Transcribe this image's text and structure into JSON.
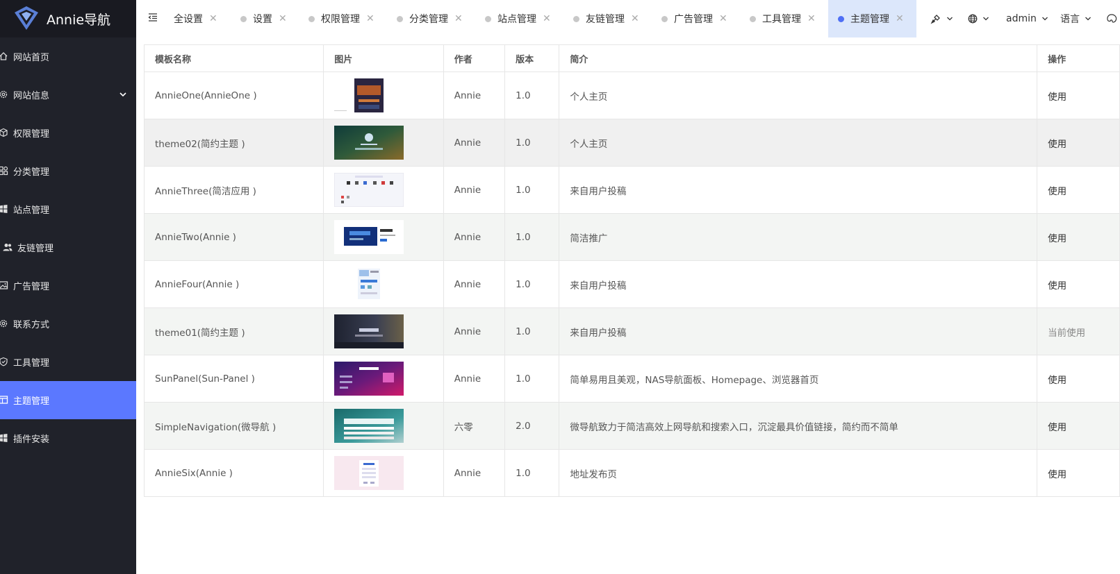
{
  "app": {
    "logo_text": "Annie导航"
  },
  "sidebar": {
    "items": [
      {
        "label": "网站首页",
        "icon": "home-icon"
      },
      {
        "label": "网站信息",
        "icon": "gear-icon",
        "has_children": true
      },
      {
        "label": "权限管理",
        "icon": "cube-icon"
      },
      {
        "label": "分类管理",
        "icon": "grid-icon"
      },
      {
        "label": "站点管理",
        "icon": "windows-icon"
      },
      {
        "label": "友链管理",
        "icon": "users-icon"
      },
      {
        "label": "广告管理",
        "icon": "image-icon"
      },
      {
        "label": "联系方式",
        "icon": "gear-icon"
      },
      {
        "label": "工具管理",
        "icon": "shield-icon"
      },
      {
        "label": "主题管理",
        "icon": "layout-icon",
        "active": true
      },
      {
        "label": "插件安装",
        "icon": "windows-icon"
      }
    ]
  },
  "tabs": [
    {
      "label": "全设置"
    },
    {
      "label": "设置"
    },
    {
      "label": "权限管理"
    },
    {
      "label": "分类管理"
    },
    {
      "label": "站点管理"
    },
    {
      "label": "友链管理"
    },
    {
      "label": "广告管理"
    },
    {
      "label": "工具管理"
    },
    {
      "label": "主题管理",
      "active": true
    }
  ],
  "header": {
    "user": "admin",
    "language": "语言"
  },
  "table": {
    "columns": [
      "模板名称",
      "图片",
      "作者",
      "版本",
      "简介",
      "操作"
    ],
    "rows": [
      {
        "name": "AnnieOne(AnnieOne )",
        "author": "Annie",
        "version": "1.0",
        "desc": "个人主页",
        "action": "使用"
      },
      {
        "name": "theme02(简约主题 )",
        "author": "Annie",
        "version": "1.0",
        "desc": "个人主页",
        "action": "使用"
      },
      {
        "name": "AnnieThree(简洁应用 )",
        "author": "Annie",
        "version": "1.0",
        "desc": "来自用户投稿",
        "action": "使用"
      },
      {
        "name": "AnnieTwo(Annie )",
        "author": "Annie",
        "version": "1.0",
        "desc": "简洁推广",
        "action": "使用"
      },
      {
        "name": "AnnieFour(Annie )",
        "author": "Annie",
        "version": "1.0",
        "desc": "来自用户投稿",
        "action": "使用"
      },
      {
        "name": "theme01(简约主题 )",
        "author": "Annie",
        "version": "1.0",
        "desc": "来自用户投稿",
        "action": "当前使用"
      },
      {
        "name": "SunPanel(Sun-Panel )",
        "author": "Annie",
        "version": "1.0",
        "desc": "简单易用且美观，NAS导航面板、Homepage、浏览器首页",
        "action": "使用"
      },
      {
        "name": "SimpleNavigation(微导航 )",
        "author": "六零",
        "version": "2.0",
        "desc": "微导航致力于简洁高效上网导航和搜索入口，沉淀最具价值链接，简约而不简单",
        "action": "使用"
      },
      {
        "name": "AnnieSix(Annie )",
        "author": "Annie",
        "version": "1.0",
        "desc": "地址发布页",
        "action": "使用"
      }
    ]
  },
  "colors": {
    "sidebar_bg": "#20222a",
    "logo_bg": "#191a21",
    "accent": "#5b78ff",
    "active_tab_bg": "#dce7fb"
  }
}
